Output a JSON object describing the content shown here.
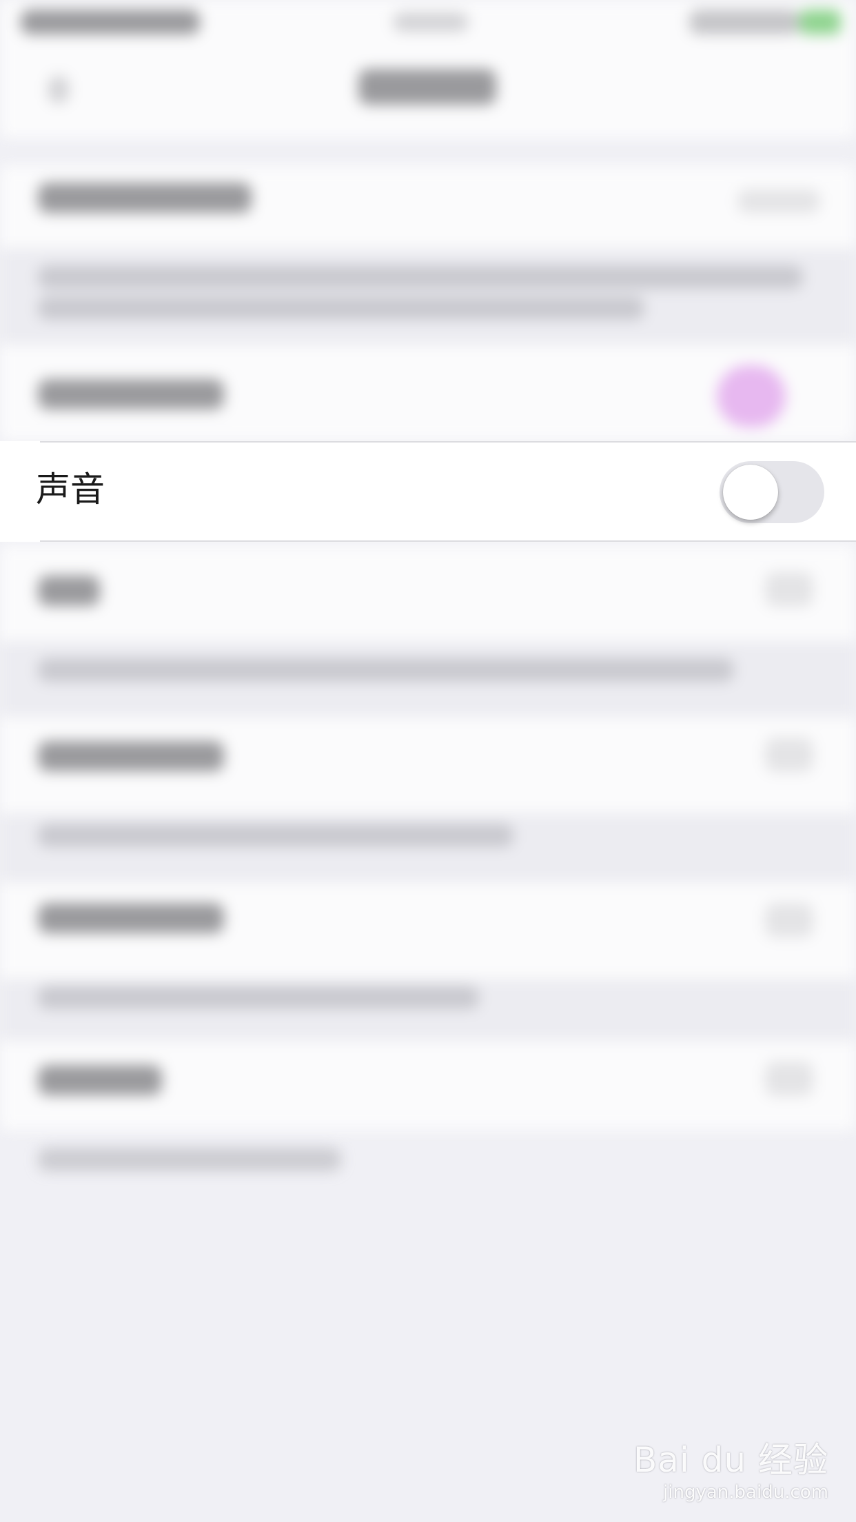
{
  "sound_row": {
    "label": "声音",
    "toggle_on": false
  },
  "watermark": {
    "logo": "Bai du 经验",
    "url": "jingyan.baidu.com"
  }
}
